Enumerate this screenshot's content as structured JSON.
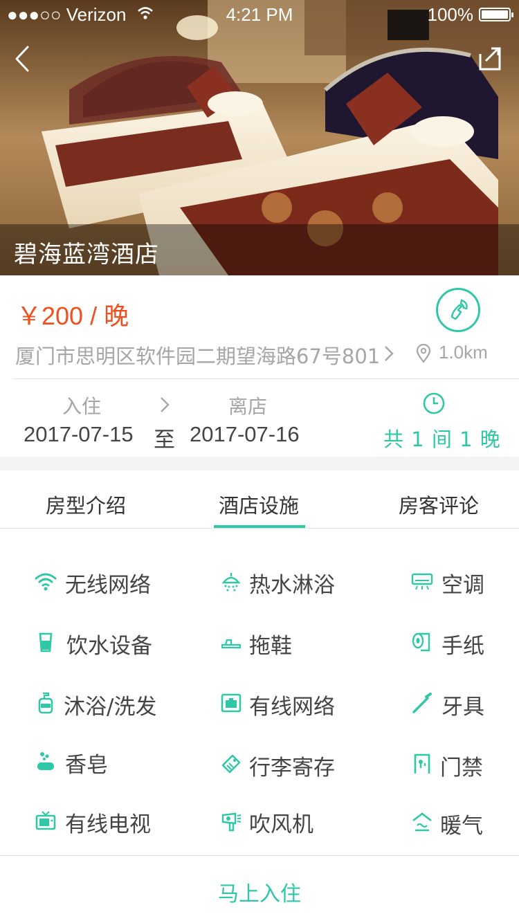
{
  "status_bar": {
    "carrier": "●●●○○ Verizon",
    "time": "4:21 PM",
    "battery": "100%"
  },
  "hotel": {
    "name": "碧海蓝湾酒店",
    "price": "￥200 / 晚",
    "address": "厦门市思明区软件园二期望海路67号801",
    "distance": "1.0km"
  },
  "stay": {
    "checkin_label": "入住",
    "checkout_label": "离店",
    "checkin_date": "2017-07-15",
    "to_label": "至",
    "checkout_date": "2017-07-16",
    "summary": "共 1 间 1 晚"
  },
  "tabs": [
    {
      "label": "房型介绍"
    },
    {
      "label": "酒店设施"
    },
    {
      "label": "房客评论"
    }
  ],
  "amenities": [
    {
      "label": "无线网络",
      "icon": "wifi-icon"
    },
    {
      "label": "热水淋浴",
      "icon": "shower-icon"
    },
    {
      "label": "空调",
      "icon": "air-conditioner-icon"
    },
    {
      "label": "饮水设备",
      "icon": "water-cup-icon"
    },
    {
      "label": "拖鞋",
      "icon": "slippers-icon"
    },
    {
      "label": "手纸",
      "icon": "toilet-paper-icon"
    },
    {
      "label": "沐浴/洗发",
      "icon": "shampoo-bottle-icon"
    },
    {
      "label": "有线网络",
      "icon": "ethernet-port-icon"
    },
    {
      "label": "牙具",
      "icon": "toothbrush-icon"
    },
    {
      "label": "香皂",
      "icon": "soap-icon"
    },
    {
      "label": "行李寄存",
      "icon": "luggage-tag-icon"
    },
    {
      "label": "门禁",
      "icon": "door-lock-icon"
    },
    {
      "label": "有线电视",
      "icon": "tv-icon"
    },
    {
      "label": "吹风机",
      "icon": "hair-dryer-icon"
    },
    {
      "label": "暖气",
      "icon": "heater-icon"
    }
  ],
  "actions": {
    "book_now": "马上入住"
  },
  "colors": {
    "accent": "#2ec8a7",
    "price": "#f0501e",
    "muted_text": "#a6a6a6"
  }
}
